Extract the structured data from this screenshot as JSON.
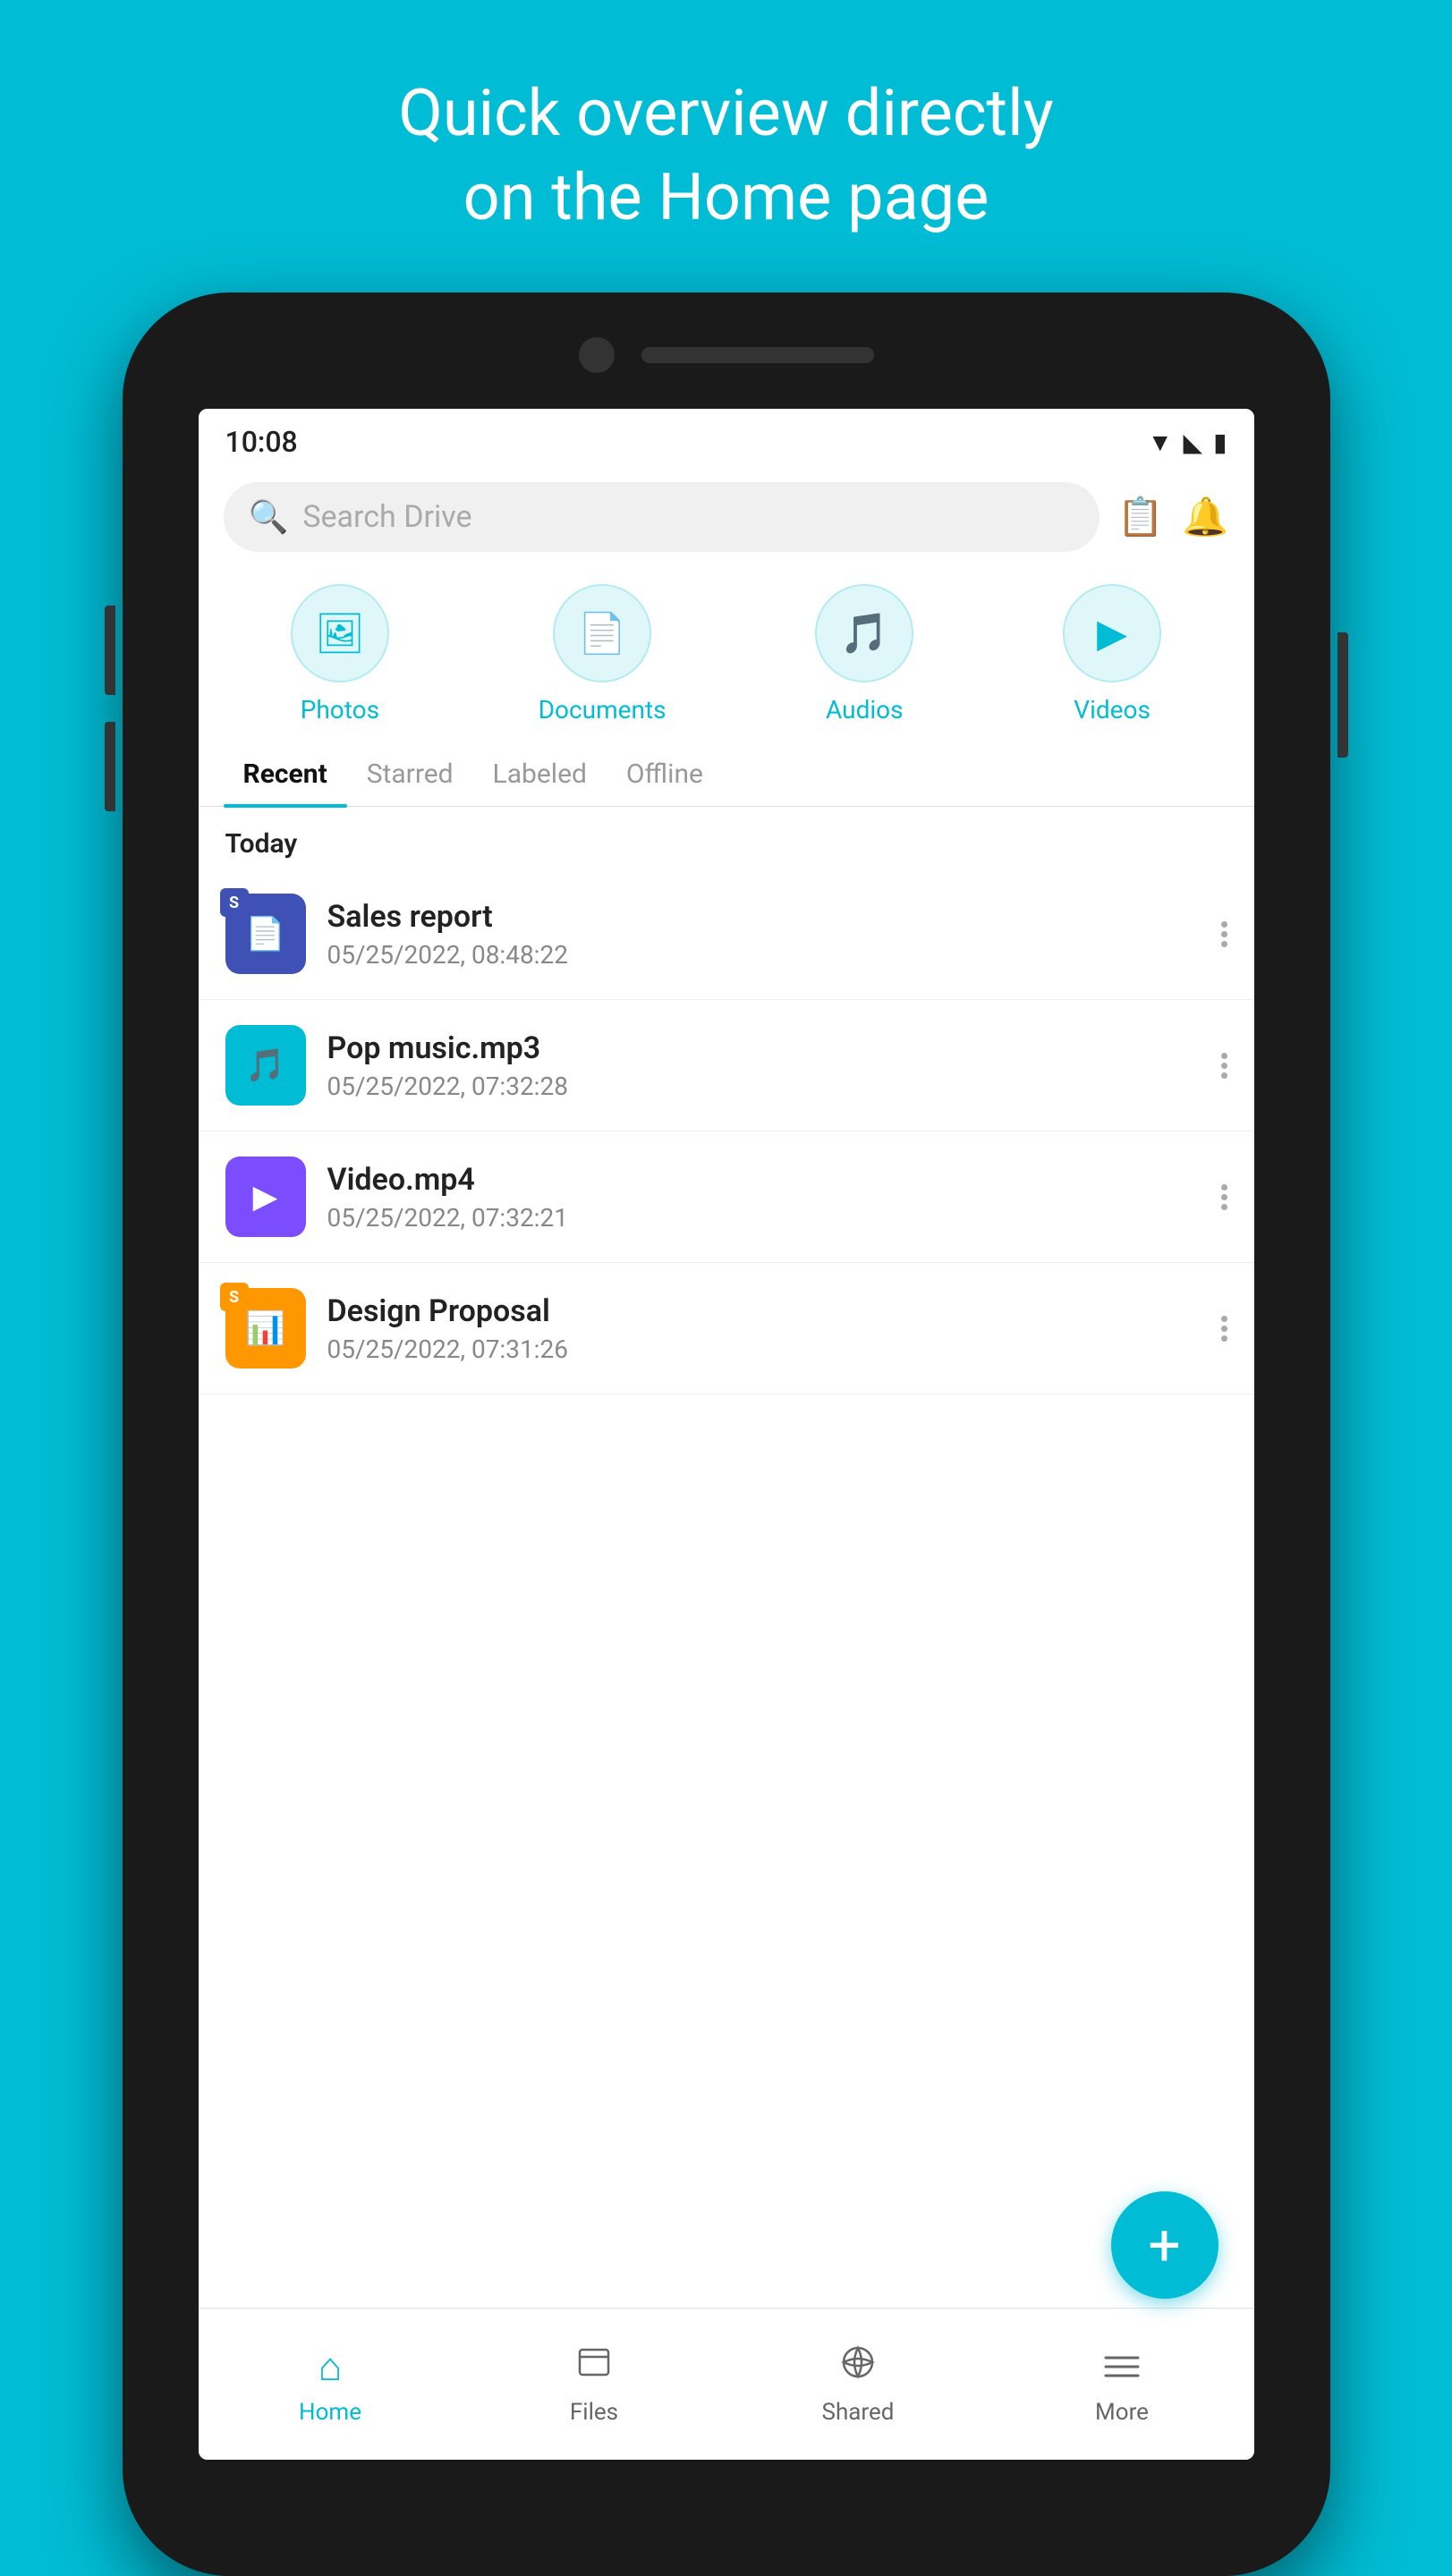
{
  "hero": {
    "line1": "Quick overview directly",
    "line2": "on the Home page"
  },
  "status_bar": {
    "time": "10:08"
  },
  "search": {
    "placeholder": "Search Drive"
  },
  "categories": [
    {
      "id": "photos",
      "label": "Photos",
      "icon": "🖼"
    },
    {
      "id": "documents",
      "label": "Documents",
      "icon": "📄"
    },
    {
      "id": "audios",
      "label": "Audios",
      "icon": "🎵"
    },
    {
      "id": "videos",
      "label": "Videos",
      "icon": "▶"
    }
  ],
  "tabs": [
    {
      "id": "recent",
      "label": "Recent",
      "active": true
    },
    {
      "id": "starred",
      "label": "Starred",
      "active": false
    },
    {
      "id": "labeled",
      "label": "Labeled",
      "active": false
    },
    {
      "id": "offline",
      "label": "Offline",
      "active": false
    }
  ],
  "section": {
    "today_label": "Today"
  },
  "files": [
    {
      "name": "Sales report",
      "date": "05/25/2022, 08:48:22",
      "type": "doc",
      "badge": "S"
    },
    {
      "name": "Pop music.mp3",
      "date": "05/25/2022, 07:32:28",
      "type": "music",
      "badge": ""
    },
    {
      "name": "Video.mp4",
      "date": "05/25/2022, 07:32:21",
      "type": "video",
      "badge": ""
    },
    {
      "name": "Design Proposal",
      "date": "05/25/2022, 07:31:26",
      "type": "slides",
      "badge": "S"
    }
  ],
  "fab": {
    "label": "+"
  },
  "bottom_nav": [
    {
      "id": "home",
      "label": "Home",
      "icon": "⌂",
      "active": true
    },
    {
      "id": "files",
      "label": "Files",
      "icon": "⬜",
      "active": false
    },
    {
      "id": "shared",
      "label": "Shared",
      "icon": "⊗",
      "active": false
    },
    {
      "id": "more",
      "label": "More",
      "icon": "≡",
      "active": false
    }
  ]
}
